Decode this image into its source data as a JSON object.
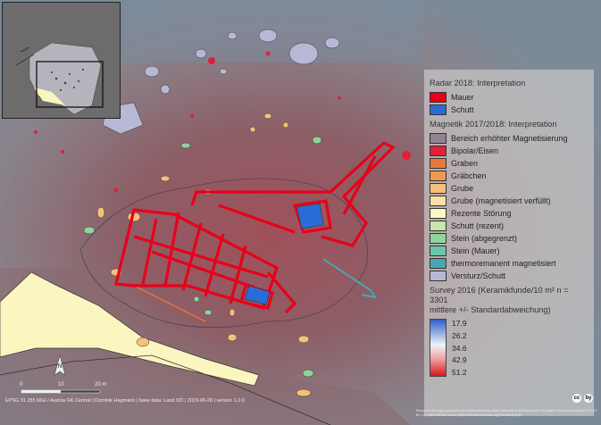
{
  "legend": {
    "radar_title": "Radar 2018: Interpretation",
    "radar_items": [
      {
        "label": "Mauer",
        "color": "#e8001a"
      },
      {
        "label": "Schutt",
        "color": "#2a6cd6"
      }
    ],
    "magnetik_title": "Magnetik 2017/2018: Interpretation",
    "magnetik_items": [
      {
        "label": "Bereich erhöhter Magnetisierung",
        "color": "#8f8494"
      },
      {
        "label": "Bipolar/Eisen",
        "color": "#e0203a"
      },
      {
        "label": "Graben",
        "color": "#e8783a"
      },
      {
        "label": "Gräbchen",
        "color": "#f09850"
      },
      {
        "label": "Grube",
        "color": "#f6bf7a"
      },
      {
        "label": "Grube (magnetisiert verfüllt)",
        "color": "#fbe0a8"
      },
      {
        "label": "Rezente Störung",
        "color": "#fff8c0"
      },
      {
        "label": "Schutt (rezent)",
        "color": "#c8e6a8"
      },
      {
        "label": "Stein (abgegrenzt)",
        "color": "#8fd49a"
      },
      {
        "label": "Stein (Mauer)",
        "color": "#6cc5a8"
      },
      {
        "label": "thermoremanent magnetisiert",
        "color": "#4aa6b0"
      },
      {
        "label": "Versturz/Schutt",
        "color": "#b8b8d6"
      }
    ],
    "survey_title_line1": "Survey 2016 (Keramikfunde/10 m² n = 3301",
    "survey_title_line2": "mittlere +/- Standardabweichung)",
    "survey_ticks": [
      "17.9",
      "26.2",
      "34.6",
      "42.9",
      "51.2"
    ]
  },
  "scale": {
    "labels": [
      "0",
      "10",
      "20 m"
    ]
  },
  "north_label": "N",
  "footer": "EPSG 31 255 MGI / Austria GK Central | Dominik Hagmann | base data: Land OÖ | 2019-06-28 | version 1.0.0",
  "credit": "Except for the logos and icons and unless otherwise stated, this work is licensed under a Creative Commons Attribution 4.0 (CC BY 4.0) International License https://creativecommons.org/licenses/by/4.0/",
  "cc_icons": [
    "cc",
    "by"
  ]
}
